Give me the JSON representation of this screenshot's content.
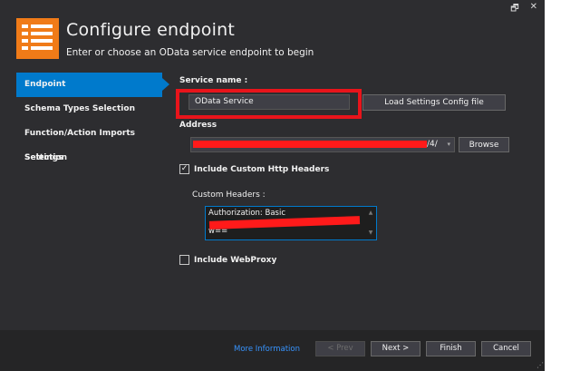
{
  "header": {
    "title": "Configure endpoint",
    "subtitle": "Enter or choose an OData service endpoint to begin"
  },
  "nav": {
    "items": [
      {
        "label": "Endpoint",
        "active": true
      },
      {
        "label": "Schema Types Selection",
        "active": false
      },
      {
        "label": "Function/Action Imports Selection",
        "active": false
      },
      {
        "label": "Settings",
        "active": false
      }
    ]
  },
  "form": {
    "service_name_label": "Service name :",
    "service_name_value": "OData Service",
    "load_settings_button": "Load Settings Config file",
    "address_label": "Address",
    "address_suffix": "/4/",
    "browse_button": "Browse",
    "include_headers_label": "Include Custom Http Headers",
    "include_headers_checked": true,
    "custom_headers_label": "Custom Headers :",
    "custom_headers_line1": "Authorization: Basic",
    "custom_headers_line3": "w==",
    "include_proxy_label": "Include WebProxy",
    "include_proxy_checked": false
  },
  "footer": {
    "more_info": "More Information",
    "prev_button": "< Prev",
    "next_button": "Next >",
    "finish_button": "Finish",
    "cancel_button": "Cancel"
  },
  "colors": {
    "accent": "#007acc",
    "logo": "#f07b18",
    "highlight": "#e8141b"
  }
}
